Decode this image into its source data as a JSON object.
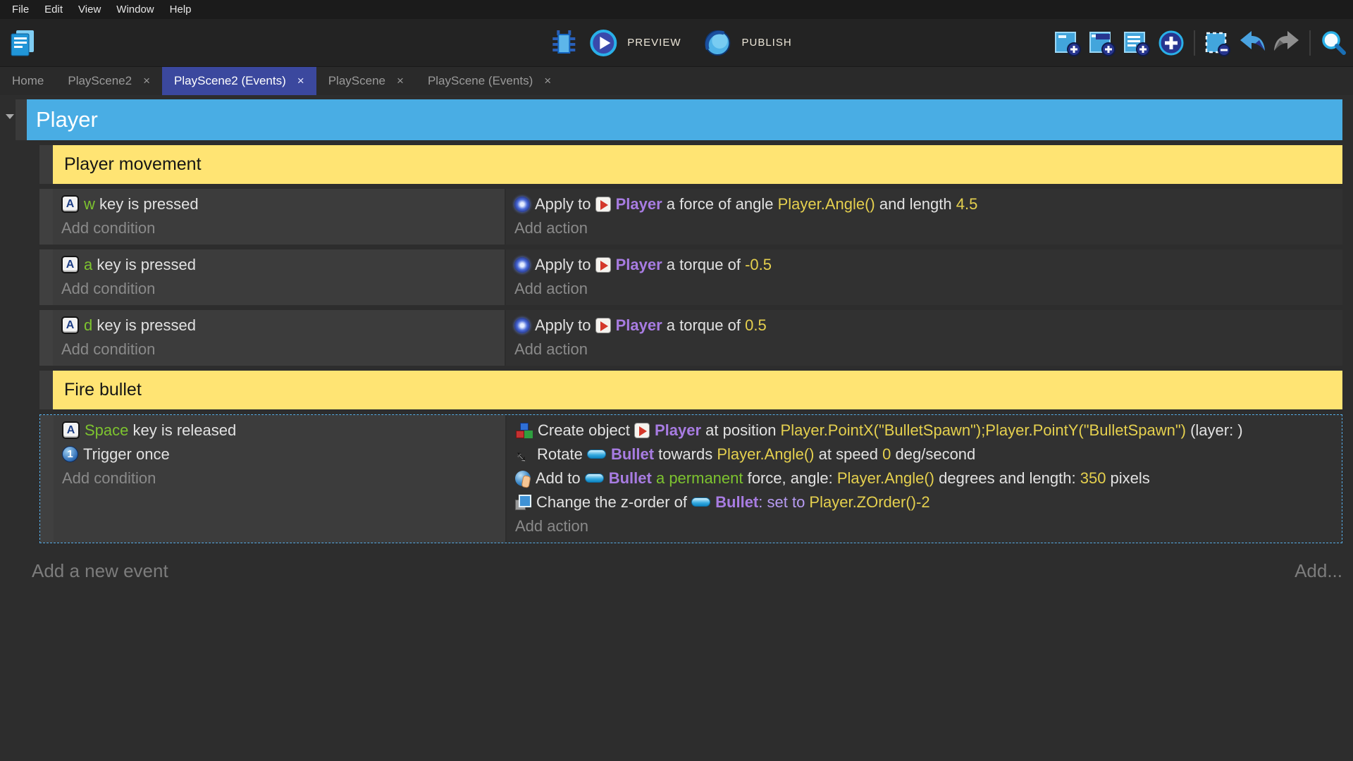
{
  "colors": {
    "group_header_blue": "#49ade4",
    "comment_yellow": "#ffe473",
    "active_tab_indigo": "#3b489e",
    "expression_yellow": "#e5d04e",
    "object_purple": "#a87ce2",
    "operator_purple": "#b79bf2",
    "key_green": "#7dc32f",
    "selection_dash_blue": "#56ace6",
    "condition_bg": "#3c3c3c",
    "action_bg": "#313131"
  },
  "menu": {
    "items": [
      "File",
      "Edit",
      "View",
      "Window",
      "Help"
    ]
  },
  "toolbar": {
    "preview_label": "PREVIEW",
    "publish_label": "PUBLISH",
    "left_icons": [
      "project-manager-icon"
    ],
    "center_icons": [
      "debugger-icon",
      "preview-play-icon",
      "publish-globe-icon"
    ],
    "right_icons": [
      "add-event-icon",
      "add-subevent-icon",
      "add-comment-icon",
      "add-circle-plus-icon",
      "remove-selection-icon",
      "undo-icon",
      "redo-icon",
      "search-icon"
    ]
  },
  "tabs": {
    "close_glyph": "×",
    "items": [
      {
        "label": "Home",
        "closable": false,
        "active": false
      },
      {
        "label": "PlayScene2",
        "closable": true,
        "active": false
      },
      {
        "label": "PlayScene2 (Events)",
        "closable": true,
        "active": true
      },
      {
        "label": "PlayScene",
        "closable": true,
        "active": false
      },
      {
        "label": "PlayScene (Events)",
        "closable": true,
        "active": false
      }
    ]
  },
  "events": {
    "group_title": "Player",
    "add_condition_label": "Add condition",
    "add_action_label": "Add action",
    "icon_glyphs": {
      "key": "A",
      "once": "1"
    },
    "footer": {
      "add_new_event": "Add a new event",
      "add_more": "Add..."
    },
    "items": [
      {
        "type": "comment",
        "text": "Player movement"
      },
      {
        "type": "event",
        "selected": false,
        "conditions": [
          {
            "segs": [
              {
                "icon": "key"
              },
              {
                "t": "w",
                "c": "g"
              },
              {
                "t": " key is pressed"
              }
            ]
          }
        ],
        "actions": [
          {
            "segs": [
              {
                "icon": "force"
              },
              {
                "t": "Apply to "
              },
              {
                "icon": "player"
              },
              {
                "t": "Player",
                "c": "o"
              },
              {
                "t": " a force of angle "
              },
              {
                "t": "Player.Angle()",
                "c": "y"
              },
              {
                "t": " and length "
              },
              {
                "t": "4.5",
                "c": "y"
              }
            ]
          }
        ]
      },
      {
        "type": "event",
        "selected": false,
        "conditions": [
          {
            "segs": [
              {
                "icon": "key"
              },
              {
                "t": "a",
                "c": "g"
              },
              {
                "t": " key is pressed"
              }
            ]
          }
        ],
        "actions": [
          {
            "segs": [
              {
                "icon": "force"
              },
              {
                "t": "Apply to "
              },
              {
                "icon": "player"
              },
              {
                "t": "Player",
                "c": "o"
              },
              {
                "t": " a torque of "
              },
              {
                "t": "-0.5",
                "c": "y"
              }
            ]
          }
        ]
      },
      {
        "type": "event",
        "selected": false,
        "conditions": [
          {
            "segs": [
              {
                "icon": "key"
              },
              {
                "t": "d",
                "c": "g"
              },
              {
                "t": " key is pressed"
              }
            ]
          }
        ],
        "actions": [
          {
            "segs": [
              {
                "icon": "force"
              },
              {
                "t": "Apply to "
              },
              {
                "icon": "player"
              },
              {
                "t": "Player",
                "c": "o"
              },
              {
                "t": " a torque of "
              },
              {
                "t": "0.5",
                "c": "y"
              }
            ]
          }
        ]
      },
      {
        "type": "comment",
        "text": "Fire bullet"
      },
      {
        "type": "event",
        "selected": true,
        "conditions": [
          {
            "segs": [
              {
                "icon": "key"
              },
              {
                "t": "Space",
                "c": "g"
              },
              {
                "t": " key is released"
              }
            ]
          },
          {
            "segs": [
              {
                "icon": "once"
              },
              {
                "t": "Trigger once"
              }
            ]
          }
        ],
        "actions": [
          {
            "segs": [
              {
                "icon": "create"
              },
              {
                "t": "Create object "
              },
              {
                "icon": "player"
              },
              {
                "t": "Player",
                "c": "o"
              },
              {
                "t": " at position "
              },
              {
                "t": "Player.PointX(\"BulletSpawn\");Player.PointY(\"BulletSpawn\")",
                "c": "y"
              },
              {
                "t": " (layer: )"
              }
            ]
          },
          {
            "segs": [
              {
                "icon": "rotate"
              },
              {
                "t": "Rotate "
              },
              {
                "icon": "bullet"
              },
              {
                "t": "Bullet",
                "c": "o"
              },
              {
                "t": " towards "
              },
              {
                "t": "Player.Angle()",
                "c": "y"
              },
              {
                "t": " at speed "
              },
              {
                "t": "0",
                "c": "y"
              },
              {
                "t": " deg/second"
              }
            ]
          },
          {
            "segs": [
              {
                "icon": "addforce"
              },
              {
                "t": "Add to "
              },
              {
                "icon": "bullet"
              },
              {
                "t": "Bullet",
                "c": "o"
              },
              {
                "t": " "
              },
              {
                "t": "a permanent",
                "c": "g"
              },
              {
                "t": " force, angle: "
              },
              {
                "t": "Player.Angle()",
                "c": "y"
              },
              {
                "t": " degrees and length: "
              },
              {
                "t": "350",
                "c": "y"
              },
              {
                "t": " pixels"
              }
            ]
          },
          {
            "segs": [
              {
                "icon": "zorder"
              },
              {
                "t": "Change the z-order of "
              },
              {
                "icon": "bullet"
              },
              {
                "t": "Bullet",
                "c": "o"
              },
              {
                "t": ": set to ",
                "c": "p"
              },
              {
                "t": "Player.ZOrder()-2",
                "c": "y"
              }
            ]
          }
        ]
      }
    ]
  }
}
